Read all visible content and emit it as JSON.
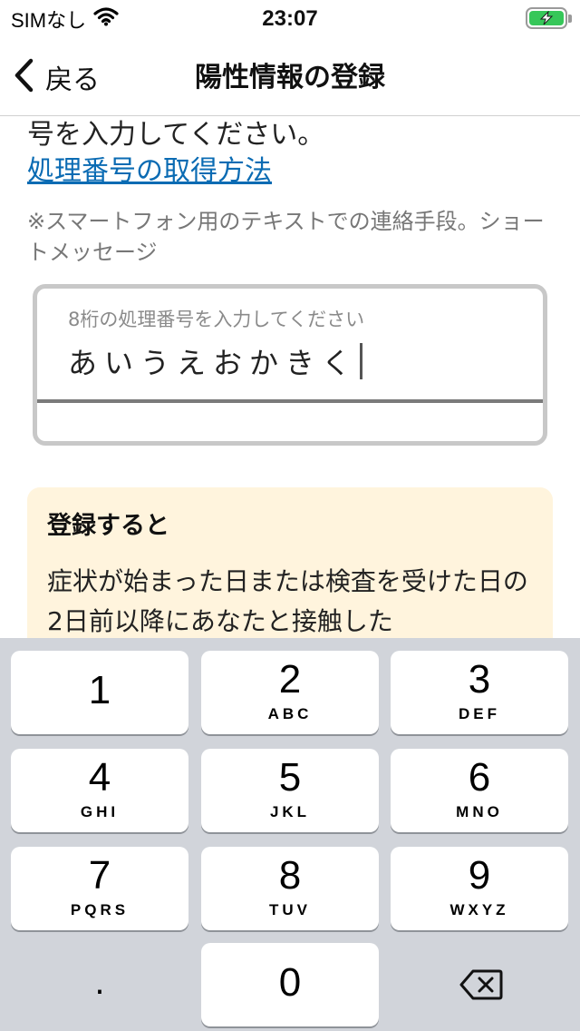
{
  "status_bar": {
    "carrier": "SIMなし",
    "time": "23:07",
    "battery_color": "#36c759"
  },
  "nav": {
    "back_label": "戻る",
    "title": "陽性情報の登録"
  },
  "content": {
    "instruction_tail": "号を入力してください。",
    "how_to_link": "処理番号の取得方法",
    "note": "※スマートフォン用のテキストでの連絡手段。ショートメッセージ",
    "input": {
      "placeholder": "8桁の処理番号を入力してください",
      "value": "あいうえおかきく"
    },
    "info_card": {
      "title": "登録すると",
      "body": "症状が始まった日または検査を受けた日の2日前以降にあなたと接触した"
    }
  },
  "keypad": {
    "keys": [
      {
        "digit": "1",
        "letters": ""
      },
      {
        "digit": "2",
        "letters": "ABC"
      },
      {
        "digit": "3",
        "letters": "DEF"
      },
      {
        "digit": "4",
        "letters": "GHI"
      },
      {
        "digit": "5",
        "letters": "JKL"
      },
      {
        "digit": "6",
        "letters": "MNO"
      },
      {
        "digit": "7",
        "letters": "PQRS"
      },
      {
        "digit": "8",
        "letters": "TUV"
      },
      {
        "digit": "9",
        "letters": "WXYZ"
      }
    ],
    "dot": ".",
    "zero": "0",
    "delete_icon": "delete-backspace-icon"
  }
}
